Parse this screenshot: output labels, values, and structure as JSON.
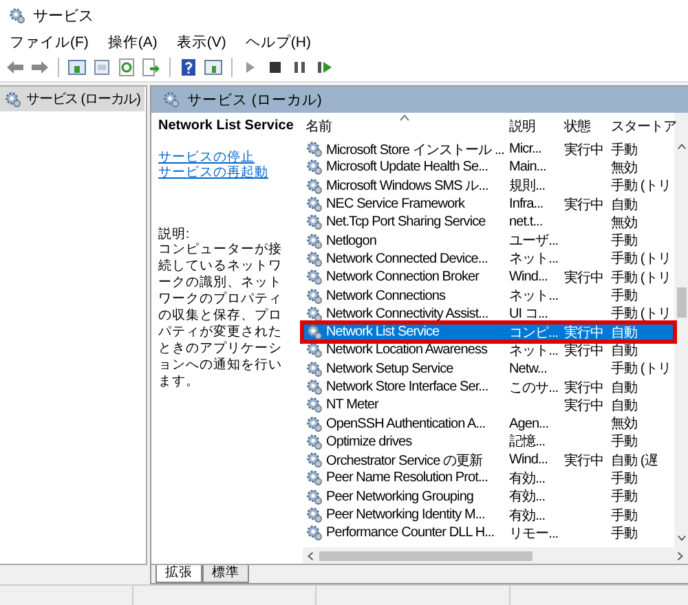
{
  "window": {
    "title": "サービス"
  },
  "menu": [
    "ファイル(F)",
    "操作(A)",
    "表示(V)",
    "ヘルプ(H)"
  ],
  "tree": [
    {
      "label": "サービス (ローカル)",
      "selected": true
    }
  ],
  "panel": {
    "header": "サービス (ローカル)"
  },
  "detail": {
    "title": "Network List Service",
    "links": [
      "サービスの停止",
      "サービスの再起動"
    ],
    "description_label": "説明:",
    "description": "コンピューターが接続しているネットワークの識別、ネットワークのプロパティの収集と保存、プロパティが変更されたときのアプリケーションへの通知を行います。"
  },
  "list": {
    "columns": [
      {
        "label": "名前",
        "sorted": true
      },
      {
        "label": "説明",
        "sorted": false
      },
      {
        "label": "状態",
        "sorted": false
      },
      {
        "label": "スタートア",
        "sorted": false
      }
    ],
    "rows": [
      {
        "name": "Microsoft Store インストール ...",
        "description": "Micr...",
        "status": "実行中",
        "startup": "手動",
        "selected": false,
        "highlighted": false
      },
      {
        "name": "Microsoft Update Health Se...",
        "description": "Main...",
        "status": "",
        "startup": "無効",
        "selected": false,
        "highlighted": false
      },
      {
        "name": "Microsoft Windows SMS ル...",
        "description": "規則...",
        "status": "",
        "startup": "手動 (トリ",
        "selected": false,
        "highlighted": false
      },
      {
        "name": "NEC Service Framework",
        "description": "Infra...",
        "status": "実行中",
        "startup": "自動",
        "selected": false,
        "highlighted": false
      },
      {
        "name": "Net.Tcp Port Sharing Service",
        "description": "net.t...",
        "status": "",
        "startup": "無効",
        "selected": false,
        "highlighted": false
      },
      {
        "name": "Netlogon",
        "description": "ユーザ...",
        "status": "",
        "startup": "手動",
        "selected": false,
        "highlighted": false
      },
      {
        "name": "Network Connected Device...",
        "description": "ネット...",
        "status": "",
        "startup": "手動 (トリ",
        "selected": false,
        "highlighted": false
      },
      {
        "name": "Network Connection Broker",
        "description": "Wind...",
        "status": "実行中",
        "startup": "手動 (トリ",
        "selected": false,
        "highlighted": false
      },
      {
        "name": "Network Connections",
        "description": "ネット...",
        "status": "",
        "startup": "手動",
        "selected": false,
        "highlighted": false
      },
      {
        "name": "Network Connectivity Assist...",
        "description": "UI コ...",
        "status": "",
        "startup": "手動 (トリ",
        "selected": false,
        "highlighted": false
      },
      {
        "name": "Network List Service",
        "description": "コンピ...",
        "status": "実行中",
        "startup": "自動",
        "selected": true,
        "highlighted": true
      },
      {
        "name": "Network Location Awareness",
        "description": "ネット...",
        "status": "実行中",
        "startup": "自動",
        "selected": false,
        "highlighted": false
      },
      {
        "name": "Network Setup Service",
        "description": "Netw...",
        "status": "",
        "startup": "手動 (トリ",
        "selected": false,
        "highlighted": false
      },
      {
        "name": "Network Store Interface Ser...",
        "description": "このサ...",
        "status": "実行中",
        "startup": "自動",
        "selected": false,
        "highlighted": false
      },
      {
        "name": "NT Meter",
        "description": "",
        "status": "実行中",
        "startup": "自動",
        "selected": false,
        "highlighted": false
      },
      {
        "name": "OpenSSH Authentication A...",
        "description": "Agen...",
        "status": "",
        "startup": "無効",
        "selected": false,
        "highlighted": false
      },
      {
        "name": "Optimize drives",
        "description": "記憶...",
        "status": "",
        "startup": "手動",
        "selected": false,
        "highlighted": false
      },
      {
        "name": "Orchestrator Service の更新",
        "description": "Wind...",
        "status": "実行中",
        "startup": "自動 (遅",
        "selected": false,
        "highlighted": false
      },
      {
        "name": "Peer Name Resolution Prot...",
        "description": "有効...",
        "status": "",
        "startup": "手動",
        "selected": false,
        "highlighted": false
      },
      {
        "name": "Peer Networking Grouping",
        "description": "有効...",
        "status": "",
        "startup": "手動",
        "selected": false,
        "highlighted": false
      },
      {
        "name": "Peer Networking Identity M...",
        "description": "有効...",
        "status": "",
        "startup": "手動",
        "selected": false,
        "highlighted": false
      },
      {
        "name": "Performance Counter DLL H...",
        "description": "リモー...",
        "status": "",
        "startup": "手動",
        "selected": false,
        "highlighted": false
      }
    ]
  },
  "tabs": [
    {
      "label": "拡張",
      "selected": true
    },
    {
      "label": "標準",
      "selected": false
    }
  ]
}
